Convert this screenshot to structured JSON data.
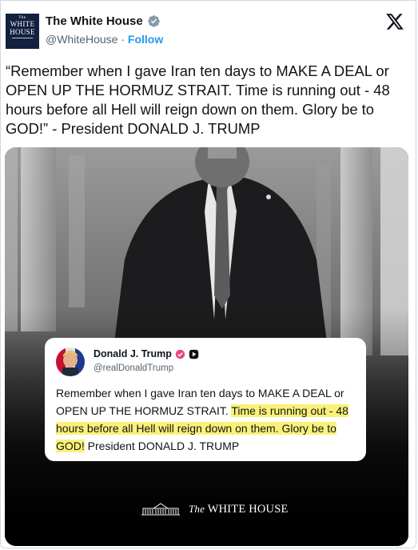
{
  "account": {
    "display_name": "The White House",
    "handle": "@WhiteHouse",
    "separator": "·",
    "follow_label": "Follow",
    "avatar_text": {
      "small": "The",
      "line1": "WHITE",
      "line2": "HOUSE"
    }
  },
  "tweet": {
    "text": "“Remember when I gave Iran ten days to MAKE A DEAL or OPEN UP THE HORMUZ STRAIT. Time is running out - 48 hours before all Hell will reign down on them. Glory be to GOD!” - President DONALD J. TRUMP"
  },
  "quote_card": {
    "name": "Donald J. Trump",
    "handle": "@realDonaldTrump",
    "text_plain": "Remember when I gave Iran ten days to MAKE A DEAL or OPEN UP THE HORMUZ STRAIT. ",
    "text_highlight_1": "Time is running out - 48 hours before all Hell will reign down on them. Glory be to GOD!",
    "text_tail": " President DONALD J. TRUMP"
  },
  "image_brand": {
    "prefix": "The",
    "name": "WHITE HOUSE"
  },
  "colors": {
    "link": "#1d9bf0",
    "text": "#0f1419",
    "muted": "#536471",
    "highlight": "#fbf178",
    "verified_gray": "#829aab",
    "avatar_navy": "#12213f"
  },
  "icons": [
    "verified-badge-icon",
    "x-logo-icon",
    "truth-social-icon",
    "pink-badge-icon",
    "white-house-building-icon"
  ]
}
